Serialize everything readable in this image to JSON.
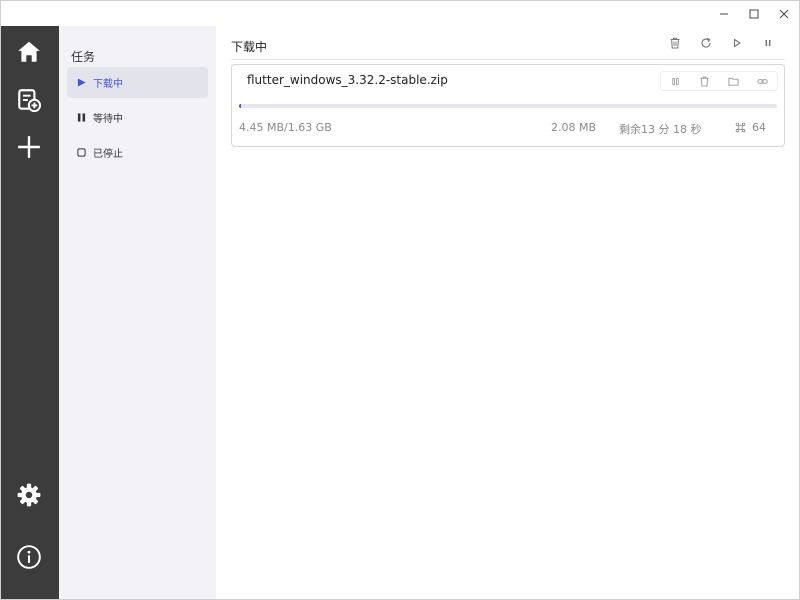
{
  "window": {
    "controls": [
      "minimize-icon",
      "maximize-icon",
      "close-icon"
    ]
  },
  "rail": {
    "icons": [
      "home-icon",
      "new-task-icon",
      "add-icon",
      "settings-icon",
      "info-icon"
    ]
  },
  "tasks": {
    "title": "任务",
    "items": [
      {
        "label": "下载中",
        "icon": "play-icon",
        "active": true
      },
      {
        "label": "等待中",
        "icon": "pause-icon",
        "active": false
      },
      {
        "label": "已停止",
        "icon": "stop-icon",
        "active": false
      }
    ]
  },
  "main": {
    "title": "下载中",
    "actions": [
      "trash-icon",
      "refresh-icon",
      "play-icon",
      "pause-icon"
    ]
  },
  "download": {
    "file_name": "flutter_windows_3.32.2-stable.zip",
    "progress": 0.0027,
    "size": "4.45 MB/1.63 GB",
    "speed": "2.08 MB",
    "remaining": "剩余13 分 18 秒",
    "connections": "64",
    "actions": [
      "pause-icon",
      "trash-icon",
      "folder-icon",
      "link-icon"
    ]
  },
  "colors": {
    "accent": "#4b50d8",
    "rail": "#3c3c3c",
    "sidebar": "#f2f2f7"
  }
}
